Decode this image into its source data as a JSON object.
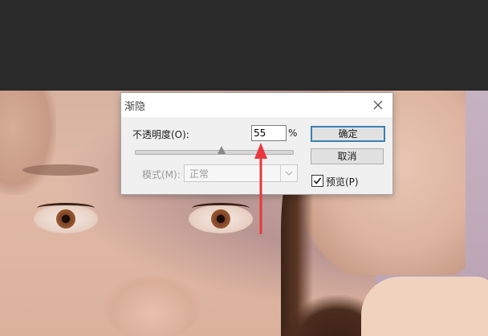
{
  "dialog": {
    "title": "渐隐",
    "opacity_label": "不透明度(O):",
    "opacity_value": "55",
    "opacity_percent": 55,
    "percent_sign": "%",
    "mode_label": "模式(M):",
    "mode_value": "正常",
    "ok_label": "确定",
    "cancel_label": "取消",
    "preview_label": "预览(P)",
    "preview_checked": true
  },
  "icons": {
    "close": "close-icon",
    "dropdown": "chevron-down-icon",
    "check": "check-icon",
    "annotation": "red-arrow-icon"
  },
  "colors": {
    "annotation_arrow": "#e8383d",
    "primary_border": "#3c7fb1",
    "dark_bar": "#2a2a2a"
  }
}
